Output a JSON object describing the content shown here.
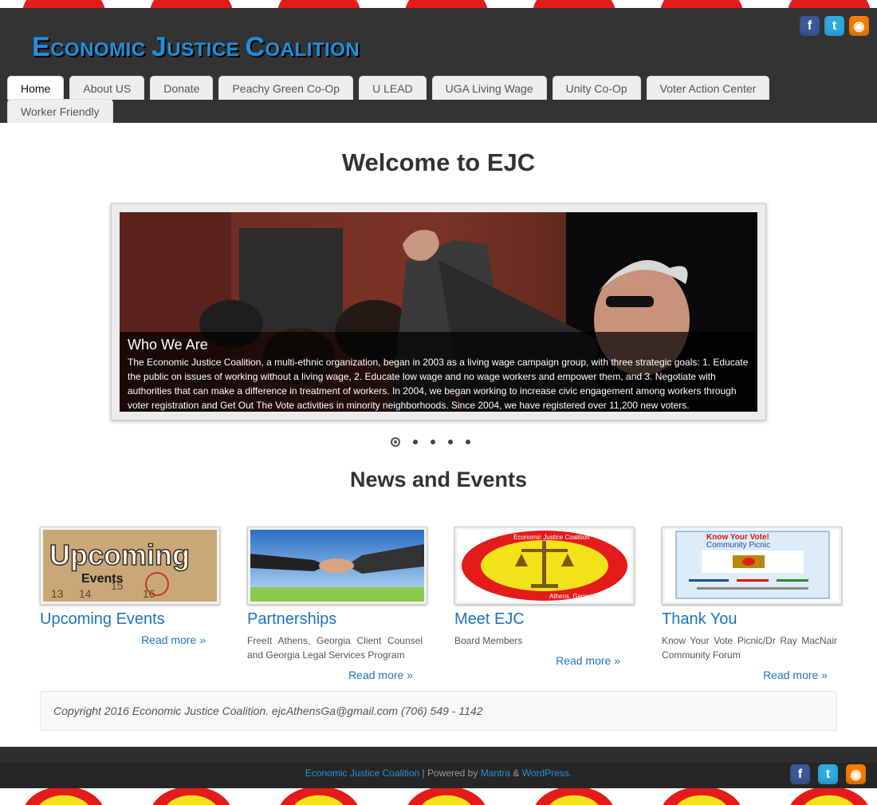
{
  "site": {
    "title_first": "E",
    "title_rest1": "CONOMIC ",
    "title_j": "J",
    "title_rest2": "USTICE ",
    "title_c": "C",
    "title_rest3": "OALITION",
    "accent": "#1e90e0",
    "header_bg": "#333333"
  },
  "social": [
    {
      "name": "facebook-icon",
      "glyph": "f"
    },
    {
      "name": "twitter-icon",
      "glyph": "t"
    },
    {
      "name": "rss-icon",
      "glyph": "◉"
    }
  ],
  "nav": {
    "row1": [
      "Home",
      "About US",
      "Donate",
      "Peachy Green Co-Op",
      "U LEAD",
      "UGA Living Wage",
      "Unity Co-Op",
      "Voter Action Center"
    ],
    "row2": [
      "Worker Friendly"
    ],
    "active": "Home"
  },
  "main": {
    "welcome": "Welcome to EJC",
    "slider": {
      "caption_title": "Who We Are",
      "caption_text": "The Economic Justice Coalition, a multi-ethnic organization, began in 2003 as a living wage campaign group, with three strategic goals: 1. Educate the public on issues of working without a living wage, 2. Educate low wage and no wage workers and empower them, and 3. Negotiate with authorities that can make a difference in treatment of workers. In 2004, we began working to increase civic engagement among workers through voter registration and Get Out The Vote activities in minority neighborhoods. Since 2004, we have registered over 11,200 new voters.",
      "slide_count": 5,
      "active_slide": 1
    },
    "news_title": "News and Events",
    "news": [
      {
        "title": "Upcoming Events",
        "desc": "",
        "read_more": "Read more »",
        "thumb_text1": "Upcoming",
        "thumb_text2": "Events"
      },
      {
        "title": "Partnerships",
        "desc": "FreeIt Athens, Georgia Client Counsel and Georgia Legal Services Program",
        "read_more": "Read more »"
      },
      {
        "title": "Meet EJC",
        "desc": "Board Members",
        "read_more": "Read more »",
        "thumb_text1": "Economic Justice Coalition",
        "thumb_text2": "Athens, Georgia"
      },
      {
        "title": "Thank You",
        "desc": "Know Your Vote Picnic/Dr Ray MacNair Community Forum",
        "read_more": "Read more »",
        "thumb_text1": "Know Your Vote!",
        "thumb_text2": "Community Picnic"
      }
    ]
  },
  "footer": {
    "copyright": "Copyright 2016 Economic Justice Coalition. ejcAthensGa@gmail.com (706) 549 - 1142",
    "credit_site": "Economic Justice Coalition",
    "credit_sep": " | Powered by ",
    "credit_theme": "Mantra",
    "credit_amp": " & ",
    "credit_wp": "WordPress."
  }
}
